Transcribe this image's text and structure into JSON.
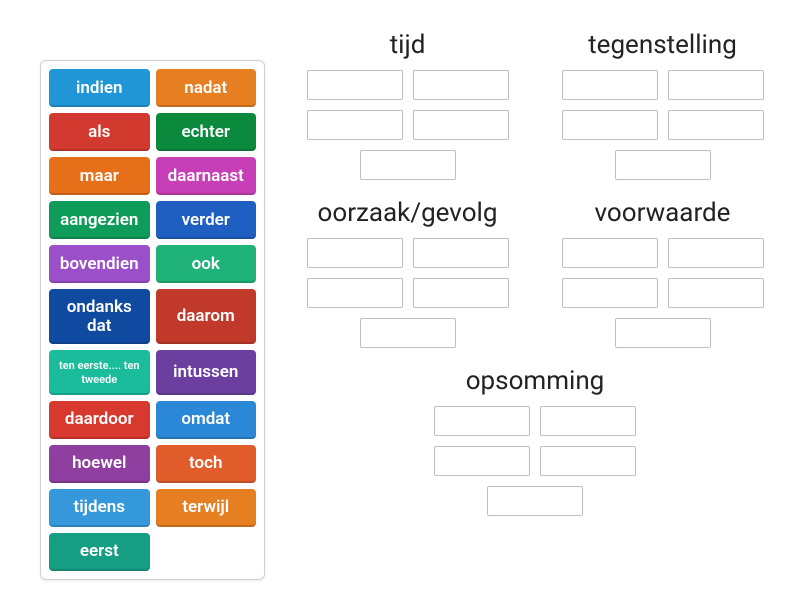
{
  "word_bank": [
    {
      "label": "indien",
      "color": "c-blue1"
    },
    {
      "label": "nadat",
      "color": "c-orange"
    },
    {
      "label": "als",
      "color": "c-red"
    },
    {
      "label": "echter",
      "color": "c-green1"
    },
    {
      "label": "maar",
      "color": "c-orange2"
    },
    {
      "label": "daarnaast",
      "color": "c-magenta"
    },
    {
      "label": "aangezien",
      "color": "c-teal"
    },
    {
      "label": "verder",
      "color": "c-blue2"
    },
    {
      "label": "bovendien",
      "color": "c-purple"
    },
    {
      "label": "ook",
      "color": "c-teal2"
    },
    {
      "label": "ondanks dat",
      "color": "c-navy"
    },
    {
      "label": "daarom",
      "color": "c-red2"
    },
    {
      "label": "ten eerste.... ten tweede",
      "color": "c-teal3",
      "small": true
    },
    {
      "label": "intussen",
      "color": "c-purple2"
    },
    {
      "label": "daardoor",
      "color": "c-red3"
    },
    {
      "label": "omdat",
      "color": "c-blue3"
    },
    {
      "label": "hoewel",
      "color": "c-purple3"
    },
    {
      "label": "toch",
      "color": "c-orange3"
    },
    {
      "label": "tijdens",
      "color": "c-blue4"
    },
    {
      "label": "terwijl",
      "color": "c-orange4"
    },
    {
      "label": "eerst",
      "color": "c-teal4"
    }
  ],
  "categories": {
    "row1": [
      {
        "title": "tijd",
        "slots": 5
      },
      {
        "title": "tegenstelling",
        "slots": 5
      }
    ],
    "row2": [
      {
        "title": "oorzaak/gevolg",
        "slots": 5
      },
      {
        "title": "voorwaarde",
        "slots": 5
      }
    ],
    "row3": [
      {
        "title": "opsomming",
        "slots": 5
      }
    ]
  }
}
